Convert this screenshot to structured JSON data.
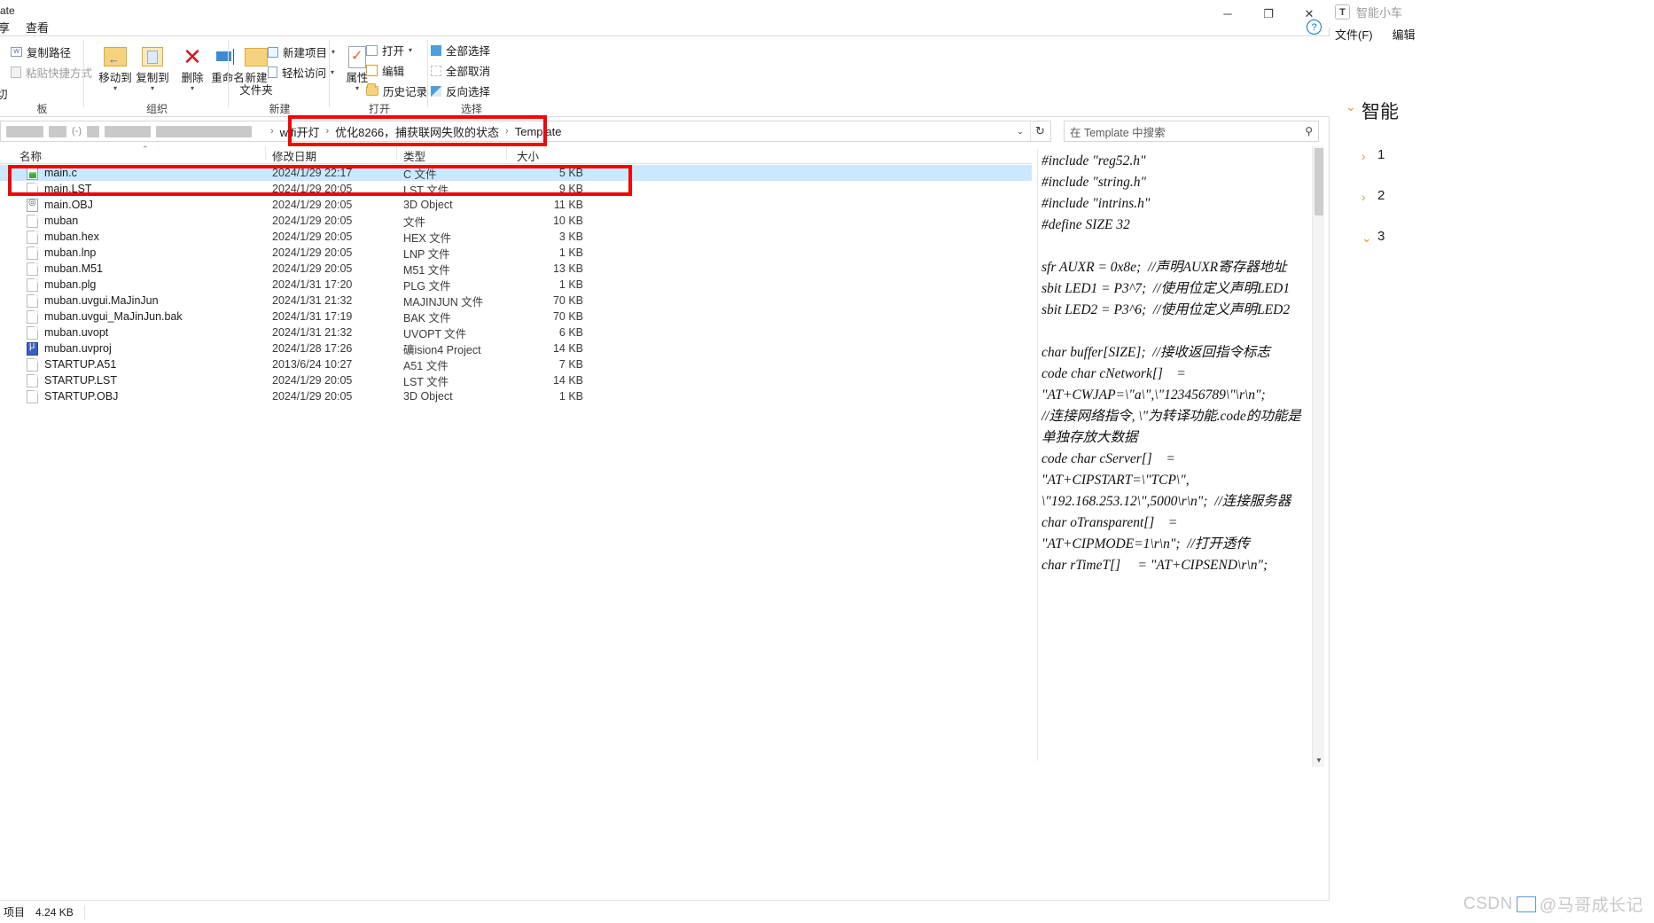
{
  "window": {
    "title_fragment": "ate",
    "controls": {
      "minimize": "─",
      "maximize": "❐",
      "close": "✕"
    },
    "help_icon": "?"
  },
  "tabs": [
    {
      "label": "享",
      "name": "tab-share"
    },
    {
      "label": "查看",
      "name": "tab-view"
    }
  ],
  "ribbon": {
    "groups": [
      {
        "label": "板",
        "name": "ribbon-group-clipboard"
      },
      {
        "label": "组织",
        "name": "ribbon-group-organize"
      },
      {
        "label": "新建",
        "name": "ribbon-group-new"
      },
      {
        "label": "打开",
        "name": "ribbon-group-open"
      },
      {
        "label": "选择",
        "name": "ribbon-group-select"
      }
    ],
    "clipboard": {
      "copy_path": "复制路径",
      "paste_shortcut": "粘贴快捷方式",
      "cut_fragment": "切"
    },
    "organize": {
      "move_to": "移动到",
      "copy_to": "复制到",
      "delete": "删除",
      "rename": "重命名"
    },
    "new": {
      "new_folder_line1": "新建",
      "new_folder_line2": "文件夹",
      "new_item": "新建项目",
      "easy_access": "轻松访问"
    },
    "open": {
      "properties": "属性",
      "open": "打开",
      "edit": "编辑",
      "history": "历史记录"
    },
    "select": {
      "select_all": "全部选择",
      "select_none": "全部取消",
      "invert_selection": "反向选择"
    }
  },
  "address": {
    "redacted_segments": [
      62,
      24,
      18,
      10,
      62,
      118
    ],
    "breadcrumbs": [
      "wifi开灯",
      "优化8266，捕获联网失败的状态",
      "Template"
    ],
    "separator": "›",
    "dropdown_icon": "⌄",
    "refresh_icon": "↻"
  },
  "search": {
    "placeholder": "在 Template 中搜索",
    "icon": "⚲"
  },
  "columns": [
    {
      "label": "名称",
      "name": "column-name"
    },
    {
      "label": "修改日期",
      "name": "column-date"
    },
    {
      "label": "类型",
      "name": "column-type"
    },
    {
      "label": "大小",
      "name": "column-size"
    }
  ],
  "sort_indicator": "⌃",
  "files": [
    {
      "name": "main.c",
      "date": "2024/1/29 22:17",
      "type": "C 文件",
      "size": "5 KB",
      "icon": "cfile",
      "selected": true
    },
    {
      "name": "main.LST",
      "date": "2024/1/29 20:05",
      "type": "LST 文件",
      "size": "9 KB",
      "icon": "plain",
      "selected": false
    },
    {
      "name": "main.OBJ",
      "date": "2024/1/29 20:05",
      "type": "3D Object",
      "size": "11 KB",
      "icon": "obj",
      "selected": false
    },
    {
      "name": "muban",
      "date": "2024/1/29 20:05",
      "type": "文件",
      "size": "10 KB",
      "icon": "plain",
      "selected": false
    },
    {
      "name": "muban.hex",
      "date": "2024/1/29 20:05",
      "type": "HEX 文件",
      "size": "3 KB",
      "icon": "plain",
      "selected": false
    },
    {
      "name": "muban.lnp",
      "date": "2024/1/29 20:05",
      "type": "LNP 文件",
      "size": "1 KB",
      "icon": "plain",
      "selected": false
    },
    {
      "name": "muban.M51",
      "date": "2024/1/29 20:05",
      "type": "M51 文件",
      "size": "13 KB",
      "icon": "plain",
      "selected": false
    },
    {
      "name": "muban.plg",
      "date": "2024/1/31 17:20",
      "type": "PLG 文件",
      "size": "1 KB",
      "icon": "plain",
      "selected": false
    },
    {
      "name": "muban.uvgui.MaJinJun",
      "date": "2024/1/31 21:32",
      "type": "MAJINJUN 文件",
      "size": "70 KB",
      "icon": "plain",
      "selected": false
    },
    {
      "name": "muban.uvgui_MaJinJun.bak",
      "date": "2024/1/31 17:19",
      "type": "BAK 文件",
      "size": "70 KB",
      "icon": "plain",
      "selected": false
    },
    {
      "name": "muban.uvopt",
      "date": "2024/1/31 21:32",
      "type": "UVOPT 文件",
      "size": "6 KB",
      "icon": "plain",
      "selected": false
    },
    {
      "name": "muban.uvproj",
      "date": "2024/1/28 17:26",
      "type": "礦ision4 Project",
      "size": "14 KB",
      "icon": "uv",
      "selected": false
    },
    {
      "name": "STARTUP.A51",
      "date": "2013/6/24 10:27",
      "type": "A51 文件",
      "size": "7 KB",
      "icon": "plain",
      "selected": false
    },
    {
      "name": "STARTUP.LST",
      "date": "2024/1/29 20:05",
      "type": "LST 文件",
      "size": "14 KB",
      "icon": "plain",
      "selected": false
    },
    {
      "name": "STARTUP.OBJ",
      "date": "2024/1/29 20:05",
      "type": "3D Object",
      "size": "1 KB",
      "icon": "plain",
      "selected": false
    }
  ],
  "statusbar": {
    "items_label": "项目",
    "size_label": "4.24 KB"
  },
  "code_panel": {
    "text": "#include \"reg52.h\"\n#include \"string.h\"\n#include \"intrins.h\"\n#define SIZE 32\n\nsfr AUXR = 0x8e;  //声明AUXR寄存器地址\nsbit LED1 = P3^7;  //使用位定义声明LED1\nsbit LED2 = P3^6;  //使用位定义声明LED2\n\nchar buffer[SIZE];  //接收返回指令标志\ncode char cNetwork[]    = \"AT+CWJAP=\\\"a\\\",\\\"123456789\\\"\\r\\n\";            //连接网络指令, \\\"为转译功能.code的功能是单独存放大数据\ncode char cServer[]    = \"AT+CIPSTART=\\\"TCP\\\", \\\"192.168.253.12\\\",5000\\r\\n\";  //连接服务器\nchar oTransparent[]    = \"AT+CIPMODE=1\\r\\n\";  //打开透传\nchar rTimeT[]     = \"AT+CIPSEND\\r\\n\";"
  },
  "scrollbar": {
    "up": "▲",
    "down": "▼"
  },
  "right_app": {
    "logo": "T",
    "title": "智能小车",
    "menu": [
      "文件(F)",
      "编辑"
    ],
    "tree": [
      {
        "chevron": "⌄",
        "text": "智能",
        "level": 1
      },
      {
        "chevron": "›",
        "text": "1",
        "level": 2
      },
      {
        "chevron": "›",
        "text": "2",
        "level": 2
      },
      {
        "chevron": "⌄",
        "text": "3",
        "level": 2
      }
    ]
  },
  "watermark": {
    "text_left": "CSDN",
    "text_right": "@马哥成长记"
  },
  "colors": {
    "selection": "#cce8ff",
    "annotation_red": "#f00707",
    "accent_blue": "#0a73c4",
    "folder_yellow": "#f6d27f"
  }
}
